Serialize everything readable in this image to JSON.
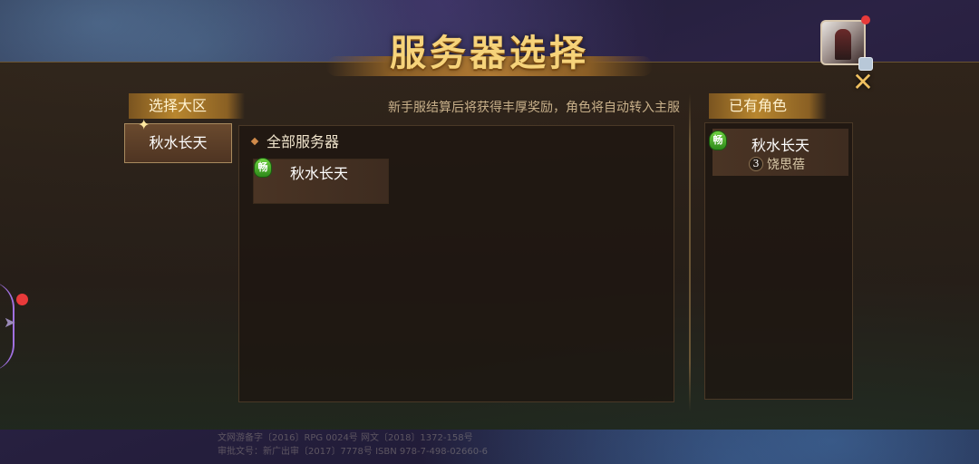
{
  "title": "服务器选择",
  "notice": "新手服结算后将获得丰厚奖励，角色将自动转入主服",
  "left_panel": {
    "label": "选择大区",
    "regions": [
      {
        "name": "秋水长天",
        "selected": true
      }
    ]
  },
  "server_list": {
    "header": "全部服务器",
    "servers": [
      {
        "name": "秋水长天",
        "status_badge": "畅",
        "status_color": "#3aa82a"
      }
    ]
  },
  "owned_panel": {
    "label": "已有角色",
    "characters": [
      {
        "server": "秋水长天",
        "level": "3",
        "name": "饶思蓓",
        "status_badge": "畅"
      }
    ]
  },
  "footer": {
    "line1": "文网游备字〔2016〕RPG 0024号 网文〔2018〕1372-158号",
    "line2": "审批文号：新广出审〔2017〕7778号 ISBN 978-7-498-02660-6"
  },
  "icons": {
    "close": "close-icon",
    "avatar": "user-avatar",
    "edge_tab": "chevron-right-icon"
  },
  "colors": {
    "title_gold": "#f6d37a",
    "badge_green": "#3aa82a",
    "notification_red": "#e83a3a"
  }
}
